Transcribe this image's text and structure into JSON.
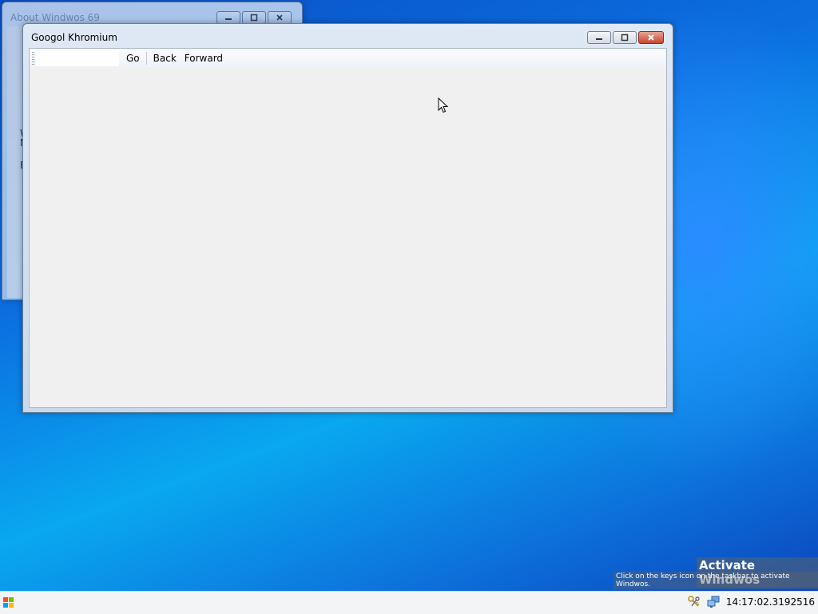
{
  "windows": {
    "about": {
      "title": "About Windwos 69",
      "fragments": [
        "W",
        "M",
        "E"
      ]
    },
    "browser": {
      "title": "Googol Khromium",
      "url_value": "",
      "go_label": "Go",
      "back_label": "Back",
      "forward_label": "Forward"
    }
  },
  "watermark": {
    "title": "Activate Windwos",
    "subtitle": "Click on the keys icon on the taskbar to activate Windwos."
  },
  "taskbar": {
    "clock": "14:17:02.3192516",
    "tray_icons": [
      "keys-icon",
      "network-icon"
    ],
    "start_icon": "windows-logo-icon"
  },
  "colors": {
    "desktop_accent": "#0b6fe0",
    "close_button": "#c8452f"
  }
}
